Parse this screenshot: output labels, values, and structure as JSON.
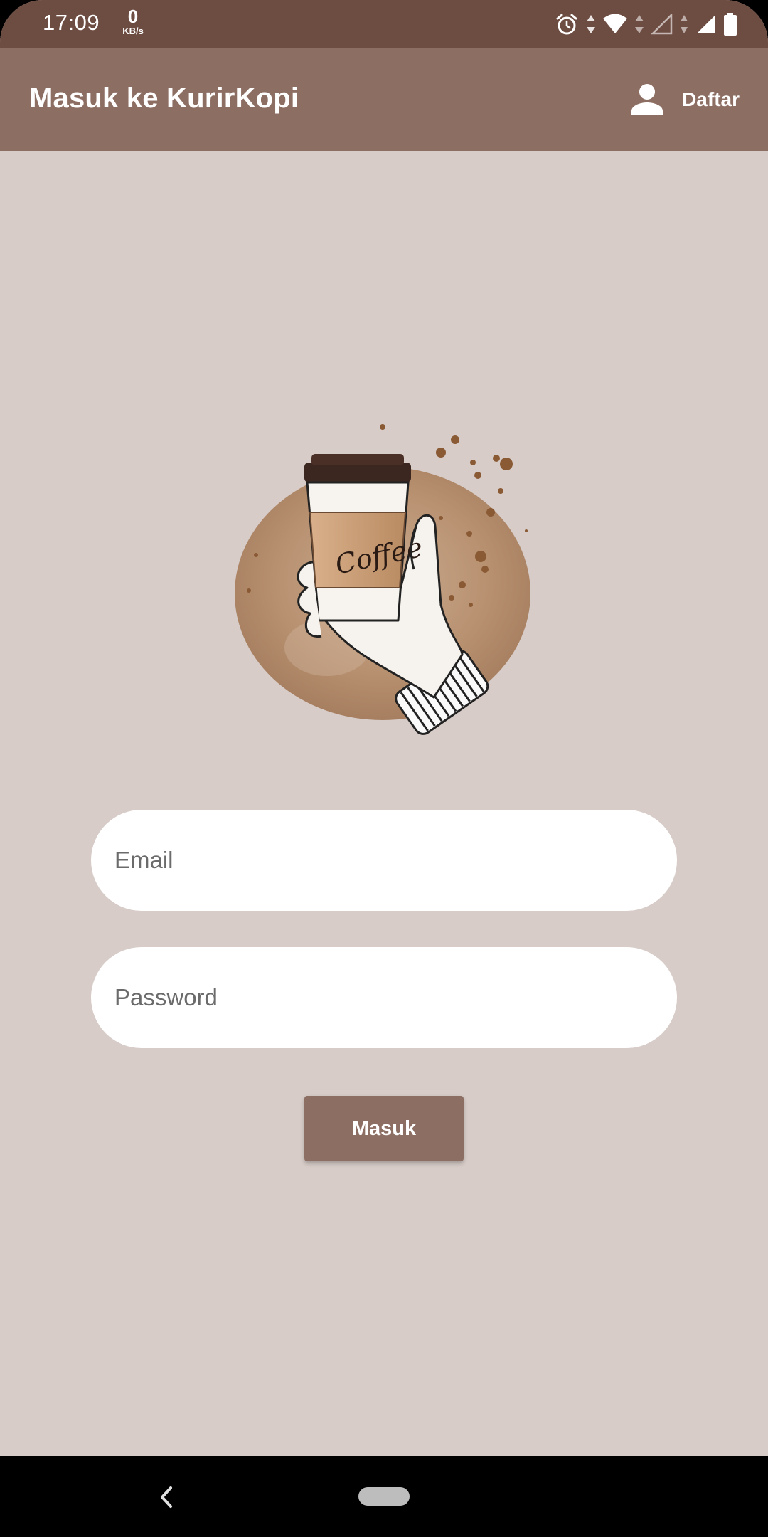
{
  "status_bar": {
    "time": "17:09",
    "net_speed_value": "0",
    "net_speed_unit": "KB/s",
    "icons": [
      "alarm-icon",
      "data-arrows-icon",
      "wifi-icon",
      "signal-empty-icon",
      "signal-full-icon",
      "battery-icon"
    ]
  },
  "app_bar": {
    "title": "Masuk ke KurirKopi",
    "register_label": "Daftar",
    "register_icon": "person-icon"
  },
  "illustration": {
    "cup_text": "Coffee",
    "icon": "coffee-cup-hand-illustration"
  },
  "form": {
    "email_placeholder": "Email",
    "email_value": "",
    "password_placeholder": "Password",
    "password_value": "",
    "submit_label": "Masuk"
  },
  "colors": {
    "status_bar": "#6d4c41",
    "app_bar": "#8d6e63",
    "background": "#d7ccc8",
    "button": "#8d6e63",
    "field": "#ffffff"
  },
  "nav_bar": {
    "icons": [
      "back-icon",
      "home-pill-icon"
    ]
  }
}
